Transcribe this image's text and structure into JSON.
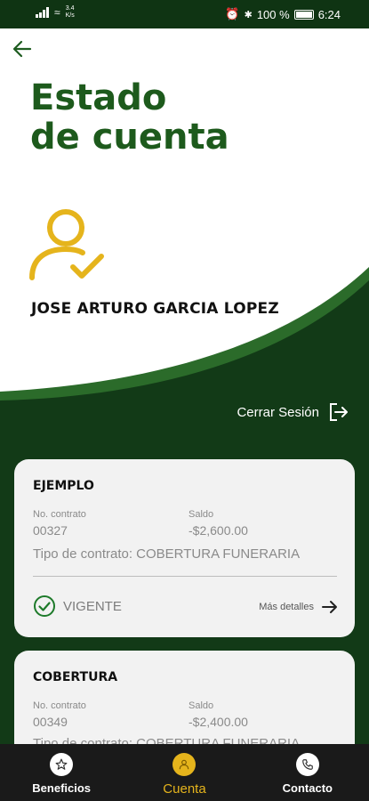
{
  "status_bar": {
    "net_speed": "3.4",
    "net_unit": "K/s",
    "battery": "100 %",
    "time": "6:24"
  },
  "header": {
    "title_line1": "Estado",
    "title_line2": "de cuenta",
    "user_name": "JOSE ARTURO GARCIA LOPEZ",
    "logout_label": "Cerrar Sesión"
  },
  "colors": {
    "brand_green": "#1d5a1c",
    "dark_green": "#123a17",
    "accent_yellow": "#e5b41c"
  },
  "contracts": [
    {
      "name": "EJEMPLO",
      "contract_label": "No. contrato",
      "contract_number": "00327",
      "balance_label": "Saldo",
      "balance": "-$2,600.00",
      "type_text": "Tipo de contrato: COBERTURA FUNERARIA",
      "status": "VIGENTE",
      "details_label": "Más detalles"
    },
    {
      "name": "COBERTURA",
      "contract_label": "No. contrato",
      "contract_number": "00349",
      "balance_label": "Saldo",
      "balance": "-$2,400.00",
      "type_text": "Tipo de contrato: COBERTURA FUNERARIA"
    }
  ],
  "nav": {
    "items": [
      {
        "label": "Beneficios",
        "icon": "star-icon"
      },
      {
        "label": "Cuenta",
        "icon": "user-icon",
        "active": true
      },
      {
        "label": "Contacto",
        "icon": "phone-icon"
      }
    ]
  }
}
